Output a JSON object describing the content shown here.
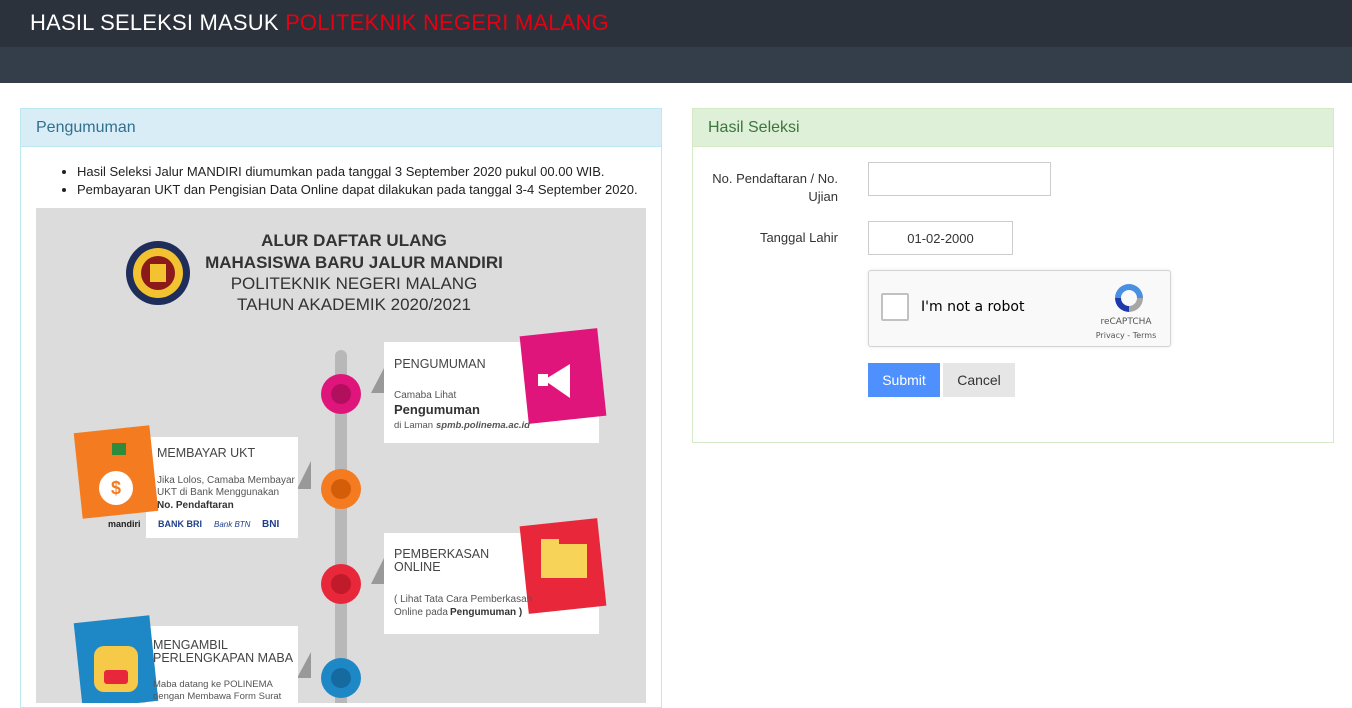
{
  "header": {
    "title_white": "HASIL SELEKSI MASUK",
    "title_red": "POLITEKNIK NEGERI MALANG"
  },
  "announcement": {
    "heading": "Pengumuman",
    "items": [
      "Hasil Seleksi Jalur MANDIRI diumumkan pada tanggal 3 September 2020 pukul 00.00 WIB.",
      "Pembayaran UKT dan Pengisian Data Online dapat dilakukan pada tanggal 3-4 September 2020."
    ],
    "infographic": {
      "title1": "ALUR DAFTAR ULANG",
      "title2": "MAHASISWA BARU JALUR MANDIRI",
      "title3": "POLITEKNIK NEGERI MALANG",
      "title4": "TAHUN AKADEMIK 2020/2021",
      "steps": [
        {
          "heading": "PENGUMUMAN",
          "line1": "Camaba Lihat",
          "line2": "Pengumuman",
          "line3": "di Laman",
          "line3b": "spmb.polinema.ac.id"
        },
        {
          "heading": "MEMBAYAR UKT",
          "line1": "Jika Lolos, Camaba Membayar",
          "line2": "UKT di Bank Menggunakan",
          "line3": "No. Pendaftaran"
        },
        {
          "heading": "PEMBERKASAN",
          "heading2": "ONLINE",
          "line1": "( Lihat Tata Cara Pemberkasan",
          "line2": "Online pada",
          "line2b": "Pengumuman )"
        },
        {
          "heading": "MENGAMBIL",
          "heading2": "PERLENGKAPAN MABA",
          "line1": "Maba datang ke POLINEMA",
          "line2": "dengan Membawa Form Surat"
        }
      ],
      "banks": [
        "mandiri",
        "BANK BRI",
        "Bank BTN",
        "BNI"
      ]
    }
  },
  "selection": {
    "heading": "Hasil Seleksi",
    "reg_label_1": "No. Pendaftaran / No.",
    "reg_label_2": "Ujian",
    "reg_value": "",
    "dob_label": "Tanggal Lahir",
    "dob_value": "01-02-2000",
    "captcha_label": "I'm not a robot",
    "captcha_brand": "reCAPTCHA",
    "captcha_terms": "Privacy - Terms",
    "submit": "Submit",
    "cancel": "Cancel"
  },
  "colors": {
    "brand_red": "#e60012",
    "submit_blue": "#4d90fe",
    "magenta": "#e0157b",
    "orange": "#f47b20",
    "red_dot": "#e8283a",
    "blue_dot": "#1e88c7"
  }
}
